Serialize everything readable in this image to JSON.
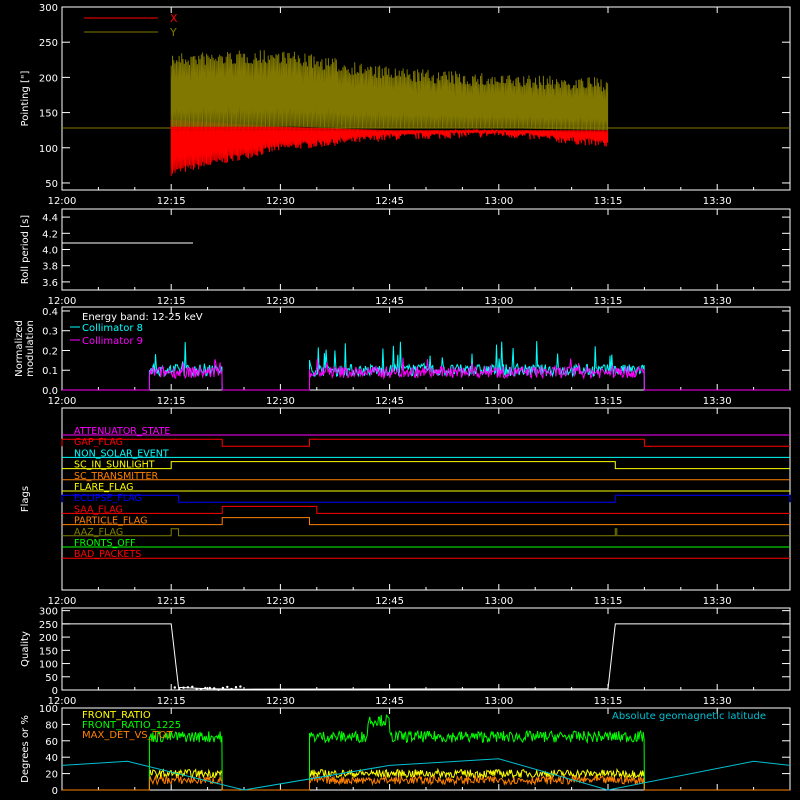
{
  "time_ticks": [
    "12:00",
    "12:15",
    "12:30",
    "12:45",
    "13:00",
    "13:15",
    "13:30"
  ],
  "colors": {
    "background": "#000000",
    "axes": "#ffffff",
    "x": "#ff0000",
    "y": "#807800",
    "collimator8": "#00ffff",
    "collimator9": "#ff00ff",
    "front_ratio": "#ffff00",
    "front_ratio_1225": "#00ff00",
    "max_det": "#ff8000",
    "latitude": "#00c0d0"
  },
  "chart_data": [
    {
      "panel": "pointing",
      "type": "area",
      "ylabel": "Pointing [\"]",
      "ylim": [
        40,
        300
      ],
      "y_ticks": [
        "50",
        "100",
        "150",
        "200",
        "250",
        "300"
      ],
      "legend": [
        "X",
        "Y"
      ],
      "legend_placement": "top-left",
      "baseline": 128,
      "series": [
        {
          "name": "X",
          "x": [
            "12:15",
            "12:30",
            "12:45",
            "13:00",
            "13:15"
          ],
          "min": [
            60,
            95,
            110,
            115,
            100
          ],
          "max": [
            140,
            130,
            125,
            125,
            125
          ]
        },
        {
          "name": "Y",
          "x": [
            "12:15",
            "12:30",
            "12:45",
            "13:00",
            "13:15"
          ],
          "min": [
            130,
            130,
            128,
            128,
            125
          ],
          "max": [
            235,
            240,
            215,
            205,
            200
          ]
        }
      ]
    },
    {
      "panel": "roll_period",
      "type": "line",
      "ylabel": "Roll period [s]",
      "ylim": [
        3.5,
        4.5
      ],
      "y_ticks": [
        "3.6",
        "3.8",
        "4.0",
        "4.2",
        "4.4"
      ],
      "series": [
        {
          "x": [
            "12:00",
            "12:05",
            "12:10",
            "12:15",
            "12:18"
          ],
          "values": [
            4.08,
            4.08,
            4.08,
            4.08,
            4.08
          ]
        }
      ]
    },
    {
      "panel": "modulation",
      "type": "line",
      "ylabel": [
        "Normalized",
        "modulation"
      ],
      "ylim": [
        0,
        0.42
      ],
      "y_ticks": [
        "0.0",
        "0.1",
        "0.2",
        "0.3",
        "0.4"
      ],
      "annotation": "Energy band: 12-25 keV",
      "legend": [
        "Collimator 8",
        "Collimator 9"
      ],
      "series": [
        {
          "name": "Collimator 8",
          "segments": [
            [
              "12:12",
              "12:22"
            ],
            [
              "12:34",
              "13:20"
            ]
          ],
          "typical": 0.1,
          "peak": 0.25
        },
        {
          "name": "Collimator 9",
          "segments": [
            [
              "12:12",
              "12:22"
            ],
            [
              "12:34",
              "13:20"
            ]
          ],
          "typical": 0.09,
          "peak": 0.17
        }
      ]
    },
    {
      "panel": "flags",
      "type": "line",
      "ylabel": "Flags",
      "flags": [
        {
          "name": "ATTENUATOR_STATE",
          "color": "#ff00ff",
          "segments": []
        },
        {
          "name": "GAP_FLAG",
          "color": "#ff0000",
          "segments": [
            [
              "12:00",
              "12:22"
            ],
            [
              "12:34",
              "13:20"
            ]
          ]
        },
        {
          "name": "NON_SOLAR_EVENT",
          "color": "#00ffff",
          "segments": []
        },
        {
          "name": "SC_IN_SUNLIGHT",
          "color": "#ffff00",
          "segments": [
            [
              "12:15",
              "13:16"
            ]
          ]
        },
        {
          "name": "SC_TRANSMITTER",
          "color": "#ff8000",
          "segments": []
        },
        {
          "name": "FLARE_FLAG",
          "color": "#ffff00",
          "segments": []
        },
        {
          "name": "ECLIPSE_FLAG",
          "color": "#0000ff",
          "segments": [
            [
              "12:00",
              "12:16"
            ],
            [
              "13:16",
              "13:40"
            ]
          ]
        },
        {
          "name": "SAA_FLAG",
          "color": "#ff0000",
          "segments": [
            [
              "12:22",
              "12:35"
            ]
          ]
        },
        {
          "name": "PARTICLE_FLAG",
          "color": "#ff8000",
          "segments": [
            [
              "12:22",
              "12:34"
            ]
          ]
        },
        {
          "name": "AAZ_FLAG",
          "color": "#808000",
          "segments": [
            [
              "12:15",
              "12:16"
            ],
            [
              "13:16",
              "13:16"
            ]
          ]
        },
        {
          "name": "FRONTS_OFF",
          "color": "#00ff00",
          "segments": []
        },
        {
          "name": "BAD_PACKETS",
          "color": "#ff0000",
          "segments": []
        }
      ]
    },
    {
      "panel": "quality",
      "type": "line",
      "ylabel": "Quality",
      "ylim": [
        0,
        310
      ],
      "y_ticks": [
        "0",
        "50",
        "100",
        "150",
        "200",
        "250",
        "300"
      ],
      "series": [
        {
          "x": [
            "12:00",
            "12:15",
            "12:16",
            "12:20",
            "12:25",
            "13:15",
            "13:16",
            "13:40"
          ],
          "values": [
            250,
            250,
            10,
            5,
            3,
            5,
            250,
            250
          ]
        }
      ]
    },
    {
      "panel": "degrees",
      "type": "line",
      "ylabel": "Degrees or %",
      "ylim": [
        0,
        100
      ],
      "y_ticks": [
        "0",
        "20",
        "40",
        "60",
        "80",
        "100"
      ],
      "legend": [
        "FRONT_RATIO",
        "FRONT_RATIO_1225",
        "MAX_DET_VS_TOT"
      ],
      "annotation": "Absolute geomagnetic latitude",
      "series": [
        {
          "name": "FRONT_RATIO",
          "segments": [
            [
              "12:12",
              "12:22"
            ],
            [
              "12:34",
              "13:20"
            ]
          ],
          "typical": 20
        },
        {
          "name": "FRONT_RATIO_1225",
          "segments": [
            [
              "12:12",
              "12:22"
            ],
            [
              "12:34",
              "13:20"
            ]
          ],
          "typical": 65,
          "peak": 95
        },
        {
          "name": "MAX_DET_VS_TOT",
          "segments": [
            [
              "12:12",
              "12:22"
            ],
            [
              "12:34",
              "13:20"
            ]
          ],
          "typical": 12
        },
        {
          "name": "Absolute geomagnetic latitude",
          "x": [
            "12:00",
            "12:09",
            "12:25",
            "12:45",
            "13:00",
            "13:15",
            "13:35",
            "13:40"
          ],
          "values": [
            30,
            35,
            0,
            30,
            38,
            0,
            35,
            30
          ]
        }
      ]
    }
  ]
}
